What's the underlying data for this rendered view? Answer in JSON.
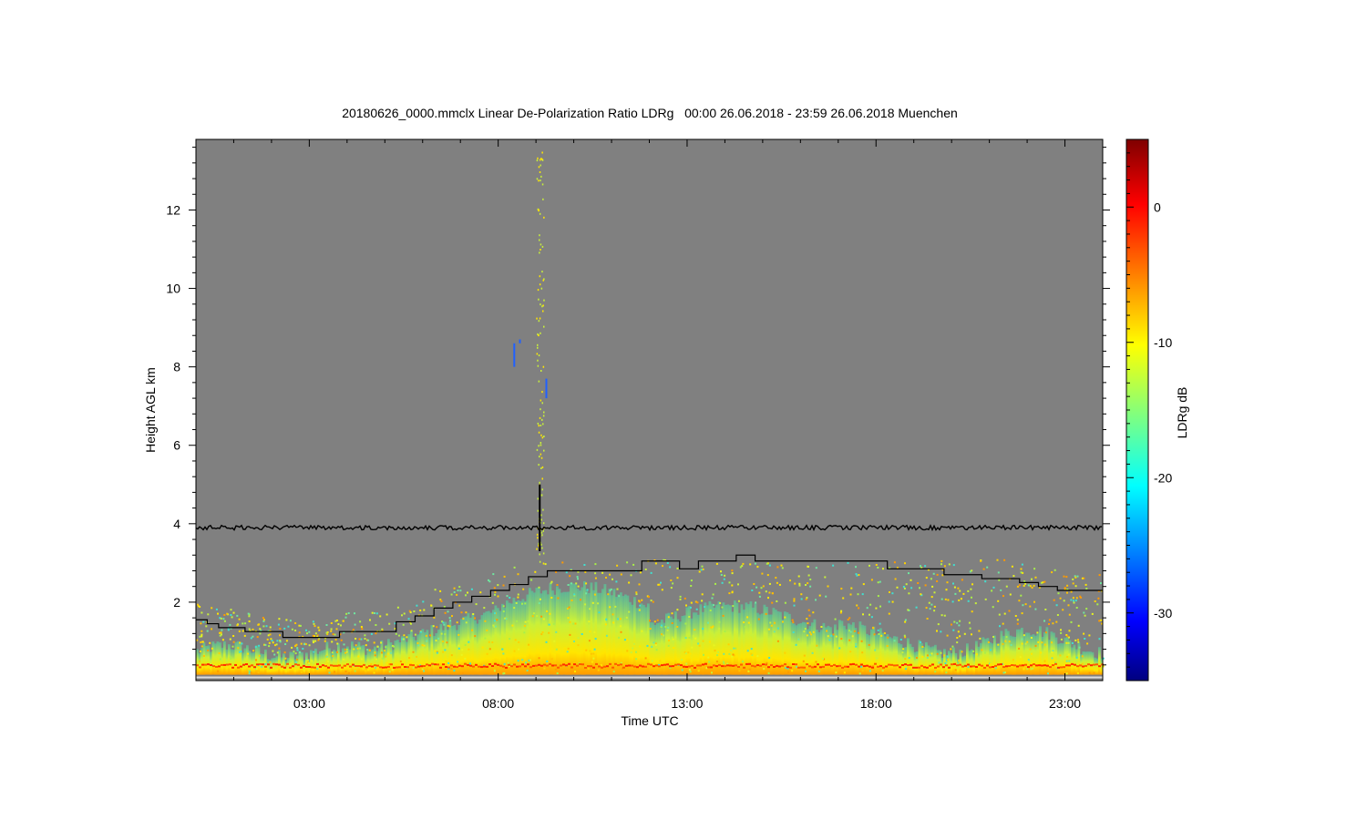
{
  "chart_data": {
    "type": "heatmap",
    "title": "20180626_0000.mmclx Linear De-Polarization Ratio LDRg   00:00 26.06.2018 - 23:59 26.06.2018 Muenchen",
    "xlabel": "Time UTC",
    "ylabel": "Height AGL km",
    "x_ticks": [
      "03:00",
      "08:00",
      "13:00",
      "18:00",
      "23:00"
    ],
    "x_tick_hours": [
      3,
      8,
      13,
      18,
      23
    ],
    "xlim_hours": [
      0,
      24
    ],
    "ylim_km": [
      0,
      13.8
    ],
    "y_ticks": [
      2,
      4,
      6,
      8,
      10,
      12
    ],
    "colorbar": {
      "label": "LDRg dB",
      "range": [
        -35,
        5
      ],
      "ticks": [
        0,
        -10,
        -20,
        -30
      ],
      "colormap": "jet"
    },
    "background_color": "#808080",
    "boundary_layer_height_km": {
      "hours": [
        0,
        0.3,
        0.6,
        1.3,
        2.3,
        3.8,
        5.3,
        5.8,
        6.3,
        6.8,
        7.3,
        7.8,
        8.3,
        8.8,
        9.3,
        11.8,
        12.8,
        13.3,
        14.3,
        14.8,
        18.3,
        19.8,
        20.8,
        21.8,
        22.3,
        22.8,
        24
      ],
      "height_km": [
        1.55,
        1.45,
        1.35,
        1.25,
        1.1,
        1.25,
        1.5,
        1.65,
        1.85,
        2.0,
        2.15,
        2.3,
        2.45,
        2.65,
        2.8,
        3.05,
        2.85,
        3.05,
        3.2,
        3.05,
        2.85,
        2.7,
        2.6,
        2.5,
        2.4,
        2.3,
        2.3
      ]
    },
    "black_line_height_km": 3.9,
    "spike_hour": 9.1,
    "spike_range_km": [
      3.3,
      5.0
    ]
  }
}
